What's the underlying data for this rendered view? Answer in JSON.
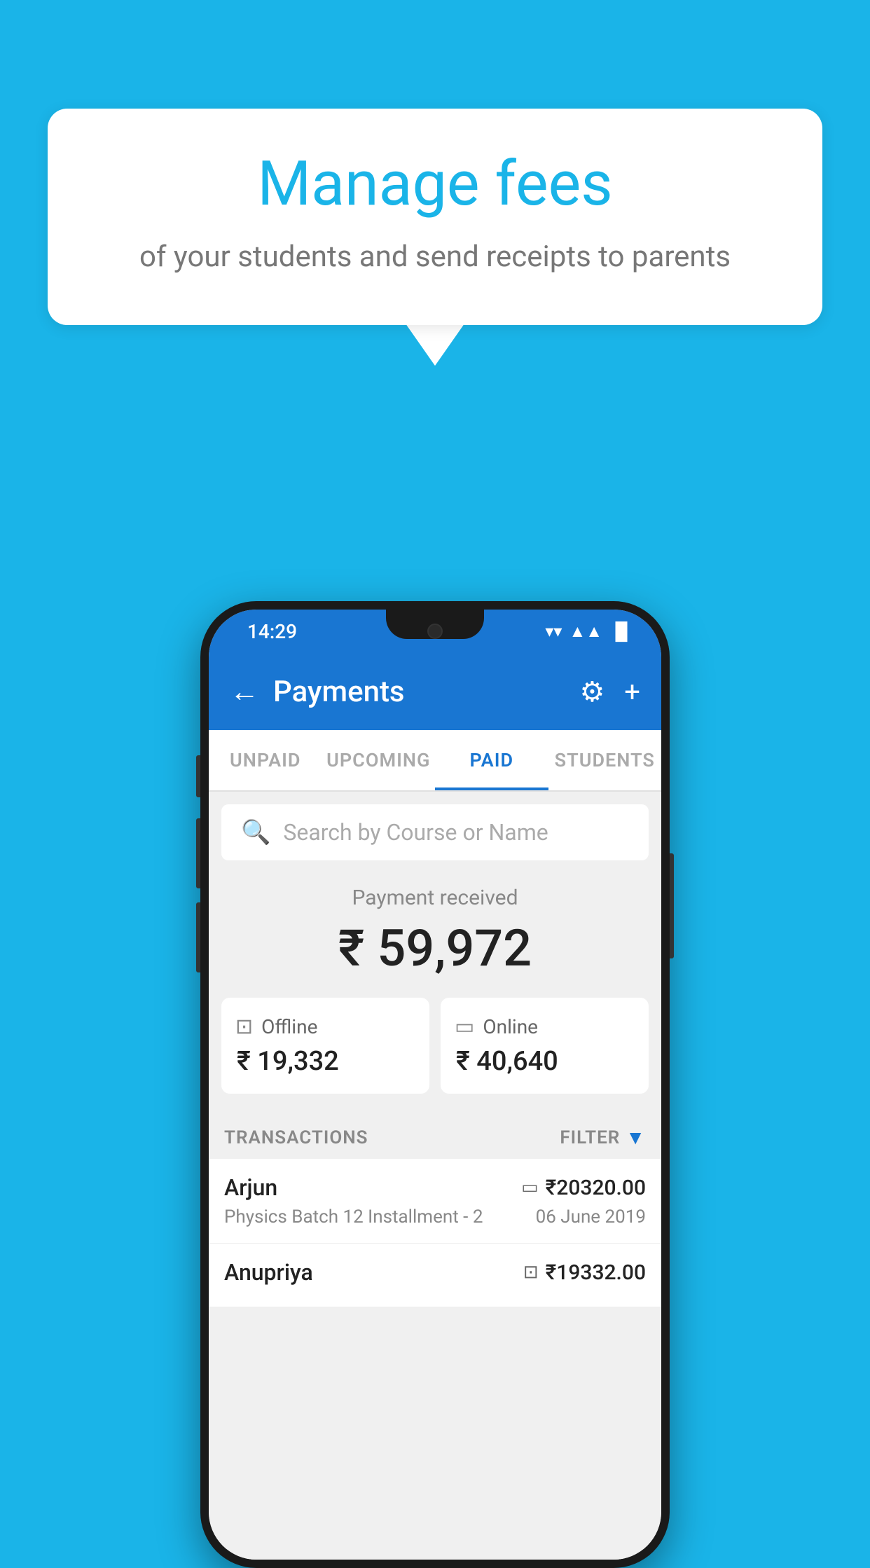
{
  "background_color": "#1ab4e8",
  "speech_bubble": {
    "title": "Manage fees",
    "subtitle": "of your students and send receipts to parents"
  },
  "status_bar": {
    "time": "14:29",
    "wifi": "▼",
    "signal": "▲",
    "battery": "▐"
  },
  "app_bar": {
    "title": "Payments",
    "back_icon": "←",
    "gear_icon": "⚙",
    "plus_icon": "+"
  },
  "tabs": [
    {
      "label": "UNPAID",
      "active": false
    },
    {
      "label": "UPCOMING",
      "active": false
    },
    {
      "label": "PAID",
      "active": true
    },
    {
      "label": "STUDENTS",
      "active": false
    }
  ],
  "search": {
    "placeholder": "Search by Course or Name"
  },
  "payment_received": {
    "label": "Payment received",
    "amount": "₹ 59,972",
    "offline": {
      "icon": "🪙",
      "label": "Offline",
      "amount": "₹ 19,332"
    },
    "online": {
      "icon": "💳",
      "label": "Online",
      "amount": "₹ 40,640"
    }
  },
  "transactions": {
    "header_label": "TRANSACTIONS",
    "filter_label": "FILTER",
    "rows": [
      {
        "name": "Arjun",
        "amount_icon": "💳",
        "amount": "₹20320.00",
        "course": "Physics Batch 12 Installment - 2",
        "date": "06 June 2019"
      },
      {
        "name": "Anupriya",
        "amount_icon": "🪙",
        "amount": "₹19332.00",
        "course": "",
        "date": ""
      }
    ]
  }
}
